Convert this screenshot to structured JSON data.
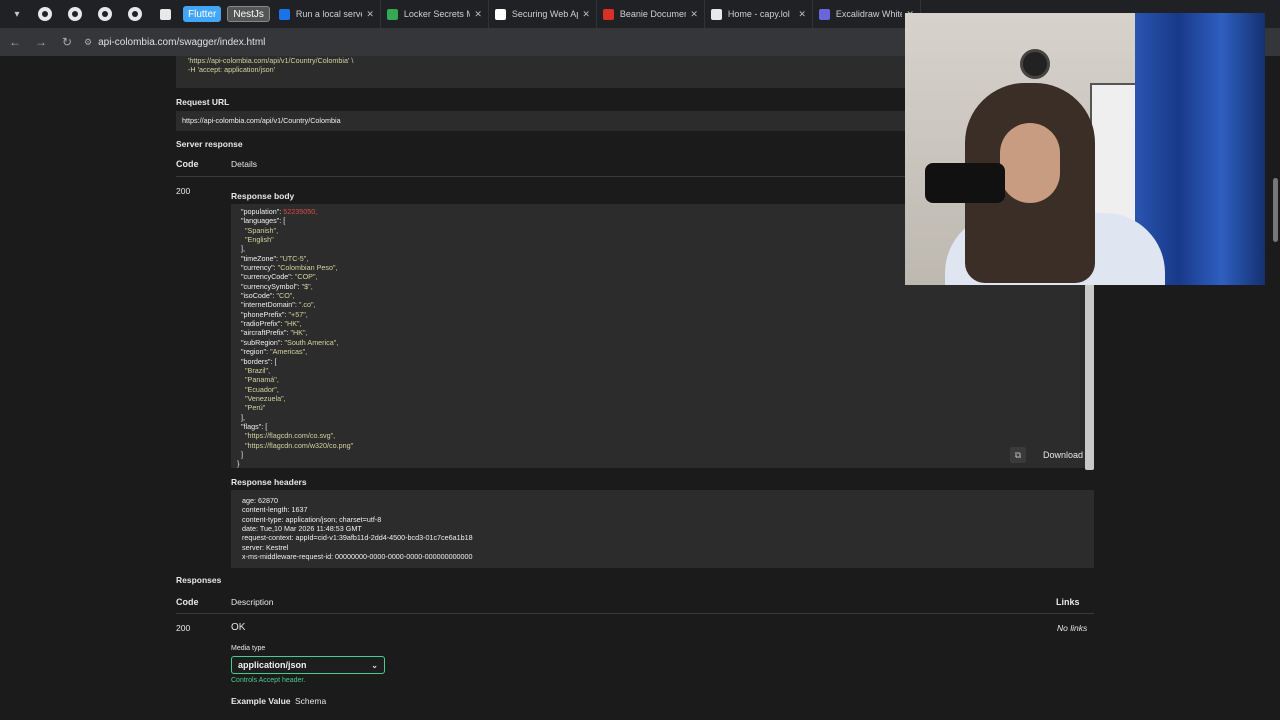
{
  "browser": {
    "pinned_badges": [
      "Flutter",
      "NestJs"
    ],
    "tabs": [
      {
        "title": "Run a local server",
        "favicon_color": "#1a73e8"
      },
      {
        "title": "Locker Secrets M",
        "favicon_color": "#34a853"
      },
      {
        "title": "Securing Web Ap",
        "favicon_color": "#ffffff"
      },
      {
        "title": "Beanie Documen",
        "favicon_color": "#d93025"
      },
      {
        "title": "Home - capy.lol",
        "favicon_color": "#e8e8e8"
      },
      {
        "title": "Excalidraw White",
        "favicon_color": "#6965db"
      }
    ],
    "address": "api-colombia.com/swagger/index.html"
  },
  "swagger": {
    "curl_lines": [
      "'https://api-colombia.com/api/v1/Country/Colombia' \\",
      "-H 'accept: application/json'"
    ],
    "request_url_label": "Request URL",
    "request_url": "https://api-colombia.com/api/v1/Country/Colombia",
    "server_response_label": "Server response",
    "code_header": "Code",
    "details_header": "Details",
    "status_code": "200",
    "response_body_label": "Response body",
    "response_body_lines": [
      "  \"population\": 52235050,",
      "  \"languages\": [",
      "    \"Spanish\",",
      "    \"English\"",
      "  ],",
      "  \"timeZone\": \"UTC-5\",",
      "  \"currency\": \"Colombian Peso\",",
      "  \"currencyCode\": \"COP\",",
      "  \"currencySymbol\": \"$\",",
      "  \"isoCode\": \"CO\",",
      "  \"internetDomain\": \".co\",",
      "  \"phonePrefix\": \"+57\",",
      "  \"radioPrefix\": \"HK\",",
      "  \"aircraftPrefix\": \"HK\",",
      "  \"subRegion\": \"South America\",",
      "  \"region\": \"Americas\",",
      "  \"borders\": [",
      "    \"Brazil\",",
      "    \"Panamá\",",
      "    \"Ecuador\",",
      "    \"Venezuela\",",
      "    \"Perú\"",
      "  ],",
      "  \"flags\": [",
      "    \"https://flagcdn.com/co.svg\",",
      "    \"https://flagcdn.com/w320/co.png\"",
      "  ]",
      "}"
    ],
    "download_label": "Download",
    "response_headers_label": "Response headers",
    "response_headers_lines": [
      "age: 62870",
      "content-length: 1637",
      "content-type: application/json; charset=utf-8",
      "date: Tue,10 Mar 2026 11:48:53 GMT",
      "request-context: appId=cid-v1:39afb11d-2dd4-4500-bcd3-01c7ce6a1b18",
      "server: Kestrel",
      "x-ms-middleware-request-id: 00000000-0000-0000-0000-000000000000"
    ],
    "responses_label": "Responses",
    "responses_code_header": "Code",
    "responses_description_header": "Description",
    "responses_links_header": "Links",
    "ok_code": "200",
    "ok_description": "OK",
    "no_links": "No links",
    "media_type_label": "Media type",
    "media_type_value": "application/json",
    "controls_accept": "Controls Accept header.",
    "example_value_tab": "Example Value",
    "schema_tab": "Schema"
  }
}
